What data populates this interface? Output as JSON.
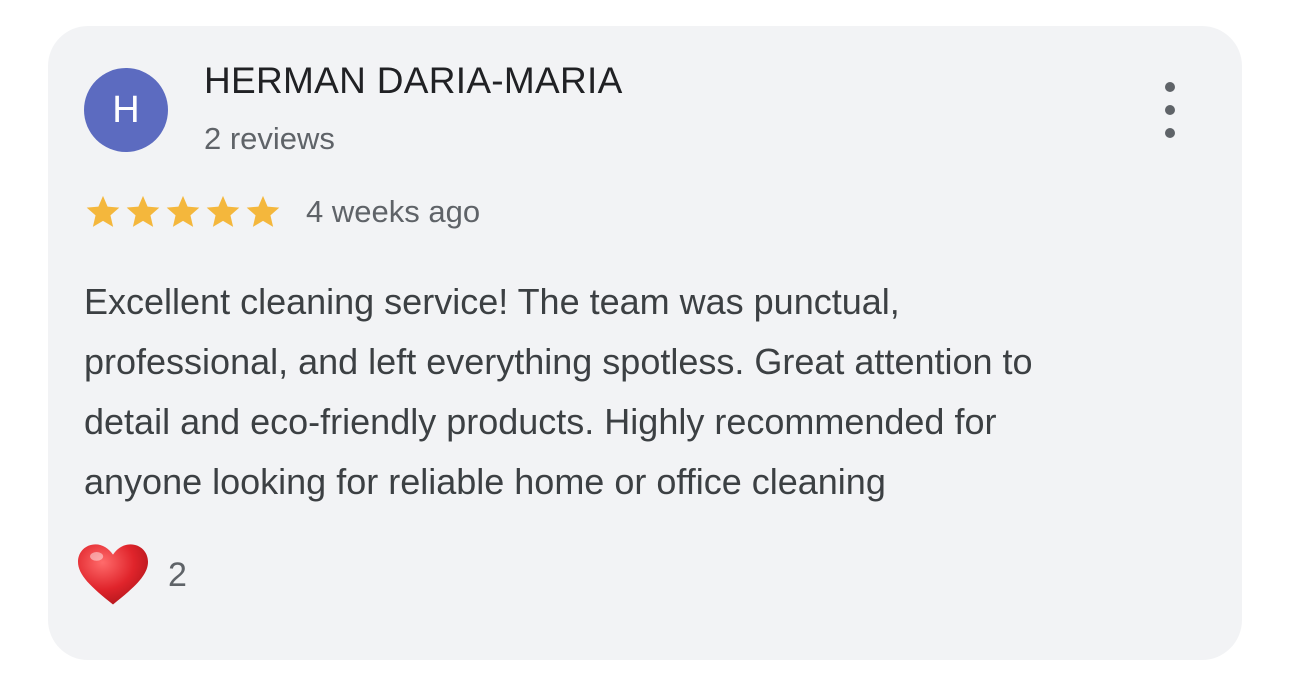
{
  "review": {
    "author": {
      "initial": "H",
      "name": "HERMAN DARIA-MARIA",
      "reviews_count": "2 reviews",
      "avatar_color": "#5c6bc0"
    },
    "rating": 5,
    "max_rating": 5,
    "time_ago": "4 weeks ago",
    "text_lines": [
      "Excellent cleaning service! The team was punctual,",
      "professional, and left everything spotless. Great attention to",
      "detail and eco-friendly products. Highly recommended for",
      "anyone looking for reliable home or office cleaning"
    ],
    "reaction": {
      "icon": "heart-icon",
      "count": "2"
    },
    "more_menu_icon": "more-vert-icon",
    "star_color": "#f4b73c",
    "heart_color": "#e0242b"
  }
}
